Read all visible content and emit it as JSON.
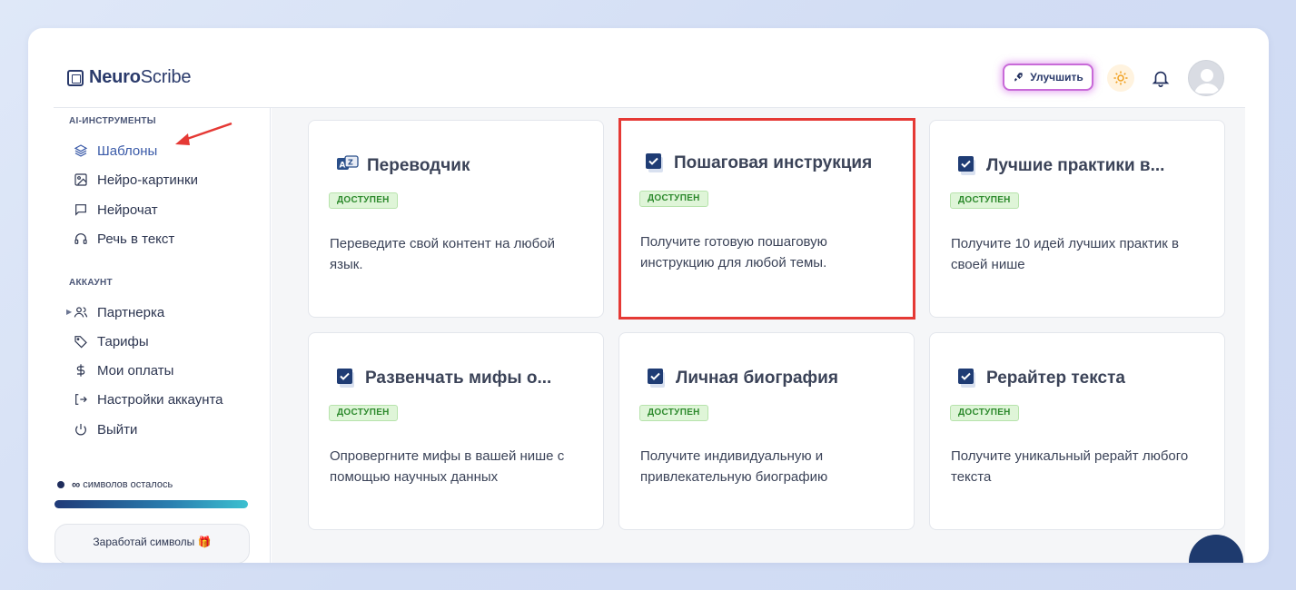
{
  "header": {
    "logo_bold": "Neuro",
    "logo_light": "Scribe",
    "upgrade_label": "Улучшить"
  },
  "sidebar": {
    "section_ai": "AI-ИНСТРУМЕНТЫ",
    "ai_items": [
      {
        "label": "Шаблоны",
        "icon": "layers-icon",
        "active": true
      },
      {
        "label": "Нейро-картинки",
        "icon": "image-icon"
      },
      {
        "label": "Нейрочат",
        "icon": "chat-icon"
      },
      {
        "label": "Речь в текст",
        "icon": "headphones-icon"
      }
    ],
    "section_account": "АККАУНТ",
    "account_items": [
      {
        "label": "Партнерка",
        "icon": "users-icon"
      },
      {
        "label": "Тарифы",
        "icon": "tag-icon"
      },
      {
        "label": "Мои оплаты",
        "icon": "dollar-icon"
      },
      {
        "label": "Настройки аккаунта",
        "icon": "login-icon"
      },
      {
        "label": "Выйти",
        "icon": "power-icon"
      }
    ],
    "usage_symbol": "∞",
    "usage_text": "символов осталось",
    "earn_label": "Заработай символы 🎁"
  },
  "cards": [
    {
      "title": "Переводчик",
      "badge": "ДОСТУПЕН",
      "desc": "Переведите свой контент на любой язык.",
      "icon": "translate-icon"
    },
    {
      "title": "Пошаговая инструкция",
      "badge": "ДОСТУПЕН",
      "desc": "Получите готовую пошаговую инструкцию для любой темы.",
      "icon": "check-icon"
    },
    {
      "title": "Лучшие практики в...",
      "badge": "ДОСТУПЕН",
      "desc": "Получите 10 идей лучших практик в своей нише",
      "icon": "check-icon"
    },
    {
      "title": "Развенчать мифы о...",
      "badge": "ДОСТУПЕН",
      "desc": "Опровергните мифы в вашей нише с помощью научных данных",
      "icon": "check-icon"
    },
    {
      "title": "Личная биография",
      "badge": "ДОСТУПЕН",
      "desc": "Получите индивидуальную и привлекательную биографию",
      "icon": "check-icon"
    },
    {
      "title": "Рерайтер текста",
      "badge": "ДОСТУПЕН",
      "desc": "Получите уникальный рерайт любого текста",
      "icon": "check-icon"
    }
  ],
  "colors": {
    "accent": "#3a5aa8",
    "selected_border": "#e53935",
    "badge_bg": "#dff5d8"
  }
}
